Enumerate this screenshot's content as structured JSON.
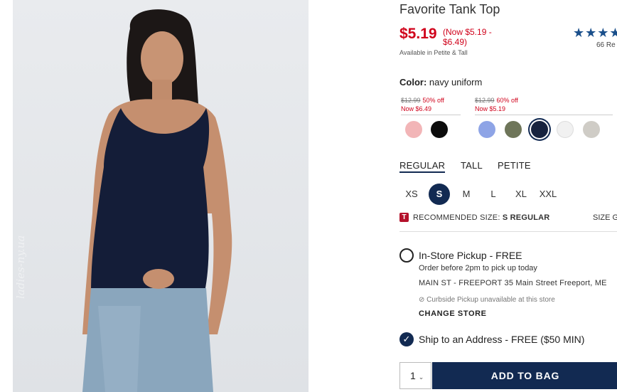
{
  "product": {
    "title": "Favorite Tank Top",
    "price": "$5.19",
    "price_range": "(Now $5.19 - $6.49)",
    "availability": "Available in Petite & Tall",
    "rating_stars": "★★★★",
    "review_count": "66 Re"
  },
  "color": {
    "label": "Color:",
    "value": "navy uniform",
    "groups": [
      {
        "was": "$12.99",
        "discount": "50% off",
        "now": "Now $6.49"
      },
      {
        "was": "$12.99",
        "discount": "60% off",
        "now": "Now $5.19"
      }
    ],
    "swatches": [
      {
        "name": "pink",
        "hex": "#f2b5b7"
      },
      {
        "name": "black",
        "hex": "#0c0c0c"
      },
      {
        "name": "periwinkle",
        "hex": "#8ea4e6"
      },
      {
        "name": "olive",
        "hex": "#6e7559"
      },
      {
        "name": "navy",
        "hex": "#17233f",
        "selected": true
      },
      {
        "name": "white",
        "hex": "#f1f1f1"
      },
      {
        "name": "heather-gray",
        "hex": "#cfccc6"
      }
    ]
  },
  "fit_tabs": [
    "REGULAR",
    "TALL",
    "PETITE"
  ],
  "active_fit": "REGULAR",
  "sizes": [
    "XS",
    "S",
    "M",
    "L",
    "XL",
    "XXL"
  ],
  "selected_size": "S",
  "recommendation": {
    "icon_letter": "T",
    "label": "RECOMMENDED SIZE:",
    "value": "S REGULAR",
    "size_guide": "SIZE G"
  },
  "pickup": {
    "title": "In-Store Pickup - FREE",
    "subtitle": "Order before 2pm to pick up today",
    "store": "MAIN ST - FREEPORT 35 Main Street  Freeport, ME",
    "curbside": "Curbside Pickup unavailable at this store",
    "change_store": "CHANGE STORE"
  },
  "ship": {
    "title": "Ship to an Address - FREE ($50 MIN)"
  },
  "cart": {
    "quantity": "1",
    "add_label": "ADD TO BAG"
  },
  "watermark": "ladies-ny.ua",
  "colors": {
    "accent": "#122a52",
    "sale": "#d0021b",
    "stars": "#1a4f8b"
  }
}
